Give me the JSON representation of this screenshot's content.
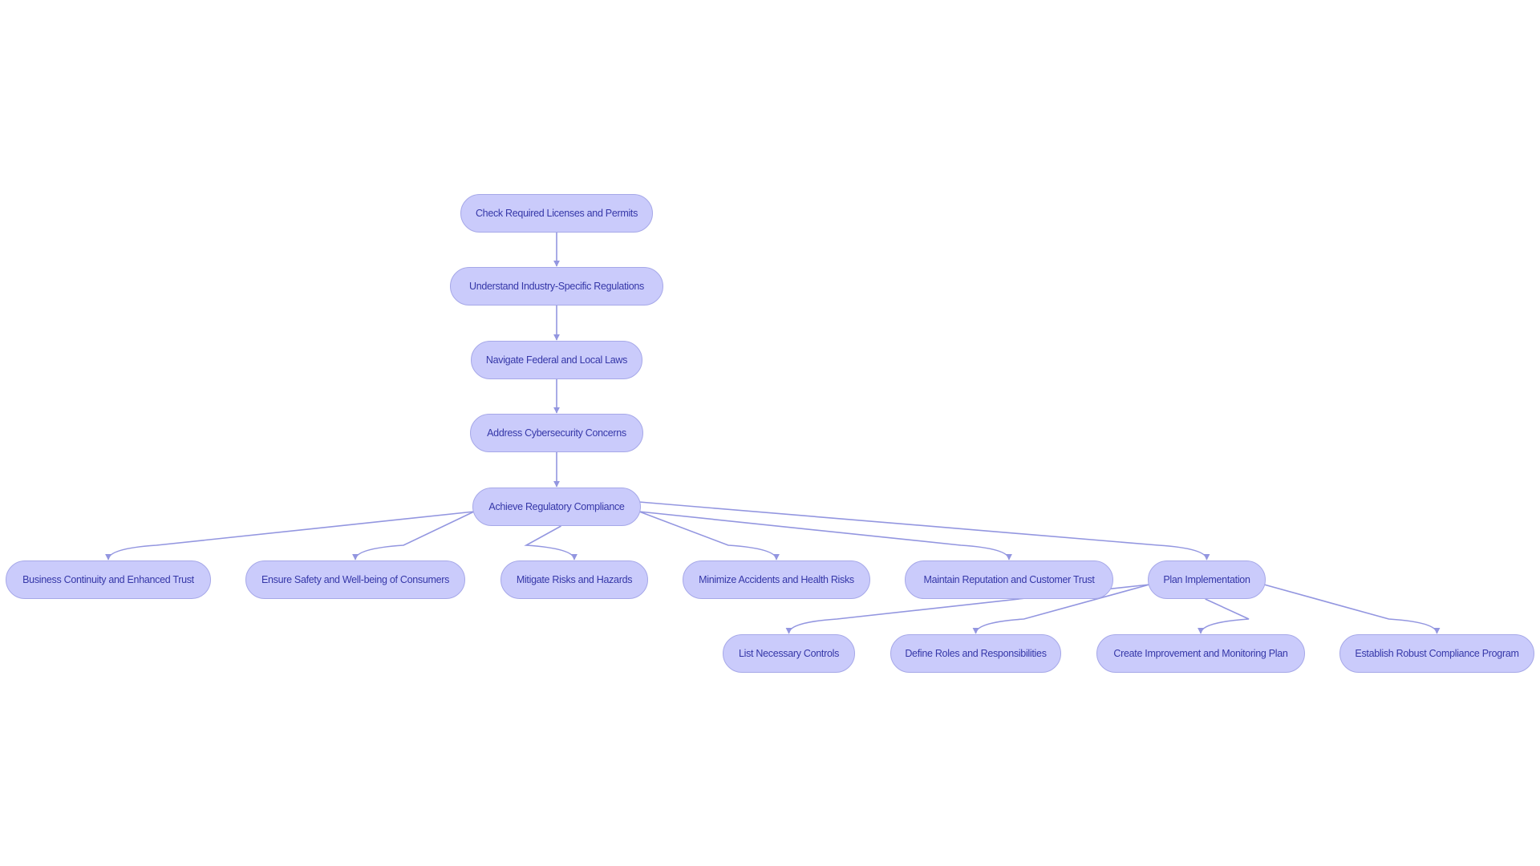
{
  "diagram": {
    "type": "flowchart",
    "colors": {
      "node_fill": "#cacbfb",
      "node_border": "#a6a8e8",
      "node_text": "#3537a8",
      "edge": "#9396e0",
      "background": "#ffffff"
    },
    "nodes": [
      {
        "id": "n1",
        "label": "Check Required Licenses and Permits"
      },
      {
        "id": "n2",
        "label": "Understand Industry-Specific Regulations"
      },
      {
        "id": "n3",
        "label": "Navigate Federal and Local Laws"
      },
      {
        "id": "n4",
        "label": "Address Cybersecurity Concerns"
      },
      {
        "id": "n5",
        "label": "Achieve Regulatory Compliance"
      },
      {
        "id": "n6",
        "label": "Business Continuity and Enhanced Trust"
      },
      {
        "id": "n7",
        "label": "Ensure Safety and Well-being of Consumers"
      },
      {
        "id": "n8",
        "label": "Mitigate Risks and Hazards"
      },
      {
        "id": "n9",
        "label": "Minimize Accidents and Health Risks"
      },
      {
        "id": "n10",
        "label": "Maintain Reputation and Customer Trust"
      },
      {
        "id": "n11",
        "label": "Plan Implementation"
      },
      {
        "id": "n12",
        "label": "List Necessary Controls"
      },
      {
        "id": "n13",
        "label": "Define Roles and Responsibilities"
      },
      {
        "id": "n14",
        "label": "Create Improvement and Monitoring Plan"
      },
      {
        "id": "n15",
        "label": "Establish Robust Compliance Program"
      }
    ],
    "edges": [
      {
        "from": "n1",
        "to": "n2"
      },
      {
        "from": "n2",
        "to": "n3"
      },
      {
        "from": "n3",
        "to": "n4"
      },
      {
        "from": "n4",
        "to": "n5"
      },
      {
        "from": "n5",
        "to": "n6"
      },
      {
        "from": "n5",
        "to": "n7"
      },
      {
        "from": "n5",
        "to": "n8"
      },
      {
        "from": "n5",
        "to": "n9"
      },
      {
        "from": "n5",
        "to": "n10"
      },
      {
        "from": "n5",
        "to": "n11"
      },
      {
        "from": "n11",
        "to": "n12"
      },
      {
        "from": "n11",
        "to": "n13"
      },
      {
        "from": "n11",
        "to": "n14"
      },
      {
        "from": "n11",
        "to": "n15"
      }
    ]
  }
}
